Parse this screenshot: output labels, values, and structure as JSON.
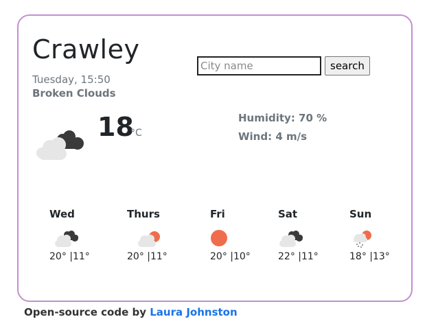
{
  "weather": {
    "city": "Crawley",
    "datetime": "Tuesday, 15:50",
    "description": "Broken Clouds",
    "temperature": "18",
    "unit": "°C",
    "humidity": "Humidity: 70 %",
    "wind": "Wind: 4 m/s",
    "icon": "broken-clouds-icon"
  },
  "search": {
    "placeholder": "City name",
    "value": "",
    "button_label": "search"
  },
  "forecast": [
    {
      "day": "Wed",
      "temps": "20° |11°",
      "icon": "broken-clouds-icon"
    },
    {
      "day": "Thurs",
      "temps": "20° |11°",
      "icon": "partly-cloudy-icon"
    },
    {
      "day": "Fri",
      "temps": "20° |10°",
      "icon": "sun-icon"
    },
    {
      "day": "Sat",
      "temps": "22° |11°",
      "icon": "broken-clouds-icon"
    },
    {
      "day": "Sun",
      "temps": "18° |13°",
      "icon": "rain-sun-icon"
    }
  ],
  "footer": {
    "prefix": "Open-source code by ",
    "author_link": "Laura Johnston"
  },
  "colors": {
    "card_border": "#c28fcf",
    "sun": "#ef6c4d",
    "cloud_dark": "#3a3a3a",
    "cloud_light": "#e6e6e6",
    "link": "#1a73e8"
  }
}
